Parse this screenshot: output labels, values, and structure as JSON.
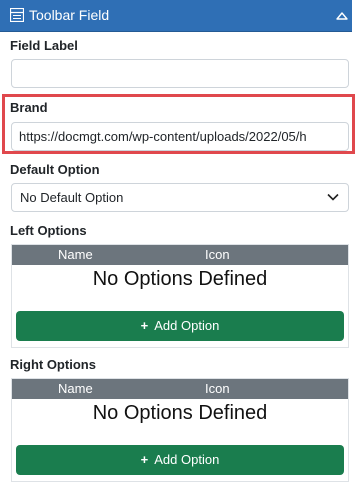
{
  "header": {
    "title": "Toolbar Field",
    "icon": "toolbar-icon",
    "collapse_icon": "caret-up-icon",
    "color": "#2f6fb5"
  },
  "fields": {
    "field_label": {
      "label": "Field Label",
      "value": ""
    },
    "brand": {
      "label": "Brand",
      "value": "https://docmgt.com/wp-content/uploads/2022/05/h"
    },
    "default_option": {
      "label": "Default Option",
      "selected": "No Default Option"
    }
  },
  "left_options": {
    "label": "Left Options",
    "columns": [
      "Name",
      "Icon"
    ],
    "empty_message": "No Options Defined",
    "add_button": "Add Option"
  },
  "right_options": {
    "label": "Right Options",
    "columns": [
      "Name",
      "Icon"
    ],
    "empty_message": "No Options Defined",
    "add_button": "Add Option"
  },
  "colors": {
    "highlight": "#e0484d",
    "add_button": "#1a7d4e",
    "table_header": "#6c757d"
  }
}
